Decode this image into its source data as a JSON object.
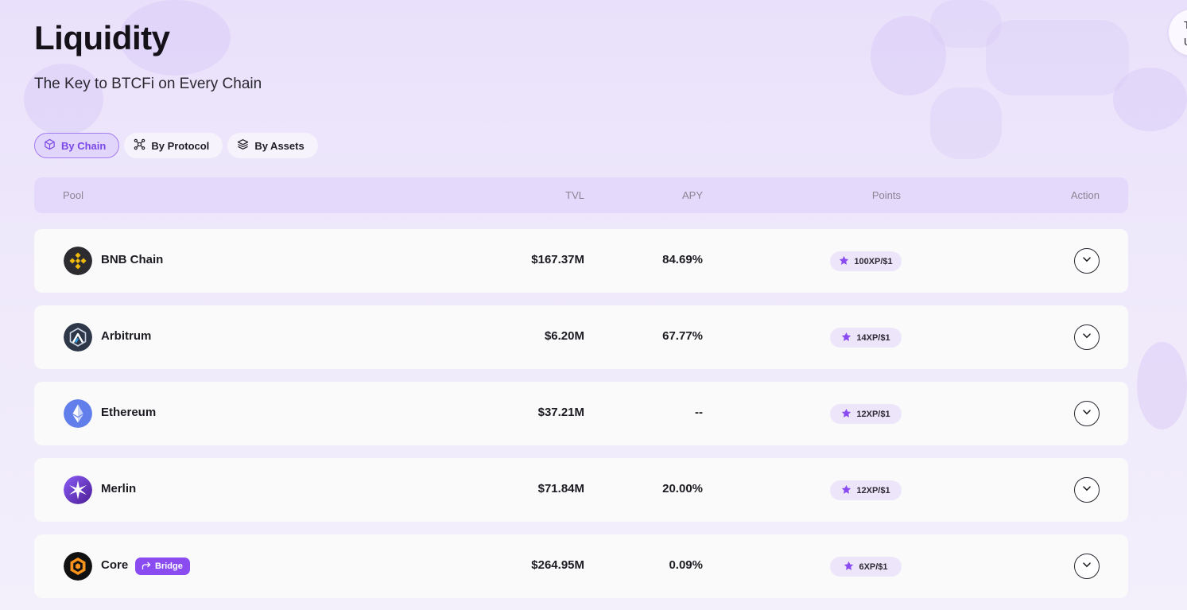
{
  "page": {
    "title": "Liquidity",
    "subtitle": "The Key to BTCFi on Every Chain"
  },
  "corner_widget": {
    "line1": "T",
    "line2": "U"
  },
  "tabs": [
    {
      "label": "By Chain",
      "icon": "cube-icon",
      "active": true
    },
    {
      "label": "By Protocol",
      "icon": "network-icon",
      "active": false
    },
    {
      "label": "By Assets",
      "icon": "layers-icon",
      "active": false
    }
  ],
  "table": {
    "headers": {
      "pool": "Pool",
      "tvl": "TVL",
      "apy": "APY",
      "points": "Points",
      "action": "Action"
    },
    "rows": [
      {
        "name": "BNB Chain",
        "logo": "bnb-chain-logo",
        "tvl": "$167.37M",
        "apy": "84.69%",
        "points": "100XP/$1",
        "tag": null
      },
      {
        "name": "Arbitrum",
        "logo": "arbitrum-logo",
        "tvl": "$6.20M",
        "apy": "67.77%",
        "points": "14XP/$1",
        "tag": null
      },
      {
        "name": "Ethereum",
        "logo": "ethereum-logo",
        "tvl": "$37.21M",
        "apy": "--",
        "points": "12XP/$1",
        "tag": null
      },
      {
        "name": "Merlin",
        "logo": "merlin-logo",
        "tvl": "$71.84M",
        "apy": "20.00%",
        "points": "12XP/$1",
        "tag": null
      },
      {
        "name": "Core",
        "logo": "core-logo",
        "tvl": "$264.95M",
        "apy": "0.09%",
        "points": "6XP/$1",
        "tag": "Bridge"
      }
    ]
  },
  "colors": {
    "accent": "#8a4cf0",
    "active_tab_bg": "#e2d5fb",
    "header_bg": "#e4d9fb",
    "points_badge_bg": "#ede6fb",
    "row_bg": "#fafafa"
  }
}
